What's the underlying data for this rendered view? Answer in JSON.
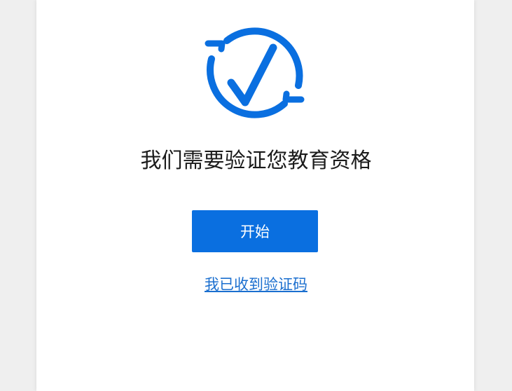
{
  "page": {
    "title": "我们需要验证您教育资格",
    "start_button_label": "开始",
    "received_code_link": "我已收到验证码"
  },
  "colors": {
    "accent": "#0a6fe0",
    "background": "#efefef",
    "card": "#ffffff",
    "link": "#1b6fcf"
  },
  "icons": {
    "logo": "circular-checkmark-icon"
  }
}
